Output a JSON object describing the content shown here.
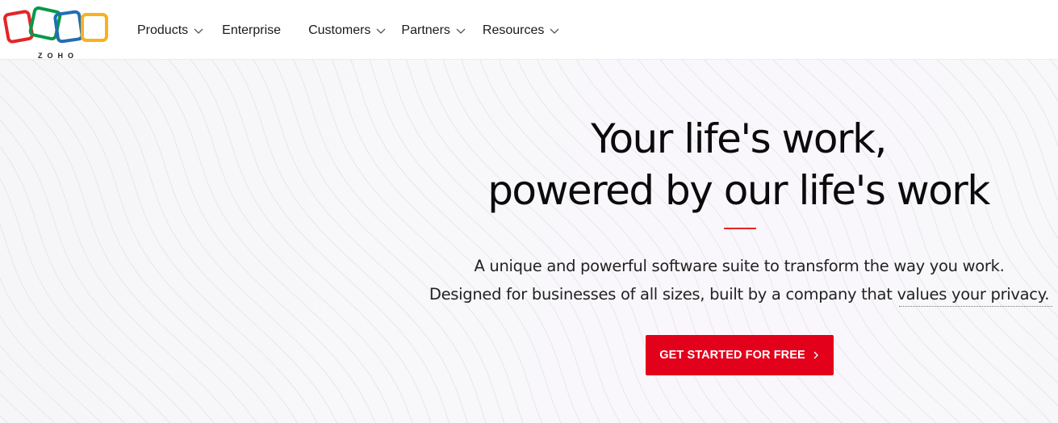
{
  "brand": {
    "name": "ZOHO",
    "colors": {
      "red": "#e42527",
      "green": "#089949",
      "blue": "#226db4",
      "yellow": "#f9b21d"
    }
  },
  "nav": {
    "items": [
      {
        "label": "Products",
        "has_dropdown": true
      },
      {
        "label": "Enterprise",
        "has_dropdown": false
      },
      {
        "label": "Customers",
        "has_dropdown": true
      },
      {
        "label": "Partners",
        "has_dropdown": true
      },
      {
        "label": "Resources",
        "has_dropdown": true
      }
    ],
    "dropdown_icon": "chevron-down-icon"
  },
  "hero": {
    "headline_line1": "Your life's work,",
    "headline_line2": "powered by our life's work",
    "subtitle_line1": "A unique and powerful software suite to transform the way you work.",
    "subtitle_line2": "Designed for businesses of all sizes, built by a company that values your privacy.",
    "cta_label": "GET STARTED FOR FREE",
    "cta_icon": "chevron-right-icon",
    "accent_color": "#e3001b"
  }
}
